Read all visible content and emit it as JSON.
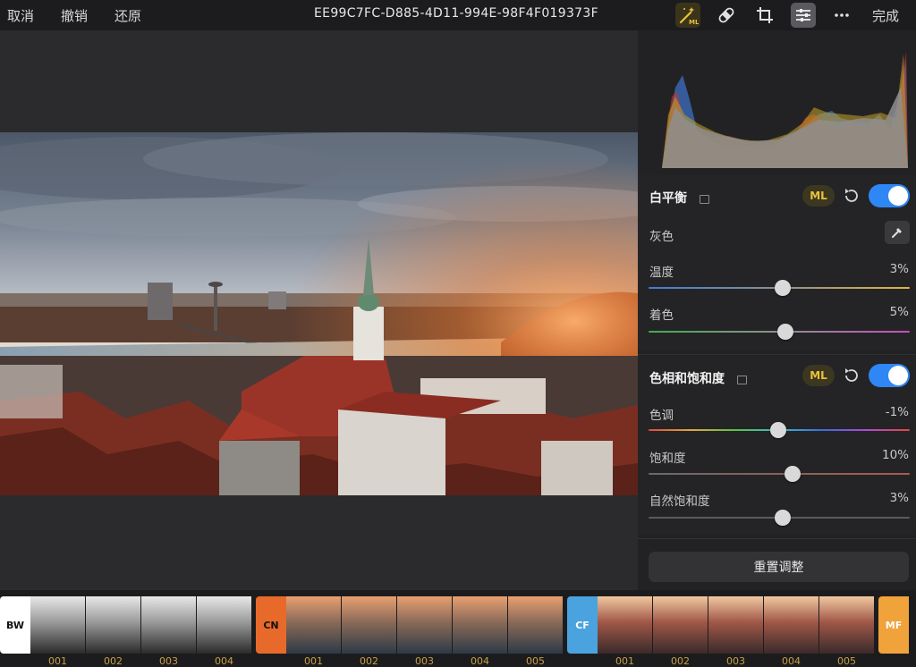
{
  "toolbar": {
    "cancel_label": "取消",
    "undo_label": "撤销",
    "redo_label": "还原",
    "title": "EE99C7FC-D885-4D11-994E-98F4F019373F",
    "ml_icon_label": "ML",
    "done_label": "完成"
  },
  "histogram": {
    "colors": {
      "red": "#c0392b",
      "green": "#6aa84f",
      "blue": "#3d6fc4",
      "luma": "#8e8e8e",
      "yellow": "#c9a227"
    }
  },
  "white_balance": {
    "title": "白平衡",
    "ml_label": "ML",
    "enabled": true,
    "gray_label": "灰色",
    "temperature": {
      "label": "温度",
      "value_text": "3%",
      "value": 3
    },
    "tint": {
      "label": "着色",
      "value_text": "5%",
      "value": 5
    }
  },
  "hue_saturation": {
    "title": "色相和饱和度",
    "ml_label": "ML",
    "enabled": true,
    "hue": {
      "label": "色调",
      "value_text": "-1%",
      "value": -1
    },
    "saturation": {
      "label": "饱和度",
      "value_text": "10%",
      "value": 10
    },
    "vibrance": {
      "label": "自然饱和度",
      "value_text": "3%",
      "value": 3
    }
  },
  "reset_button_label": "重置调整",
  "filters": {
    "groups": [
      {
        "tag": "BW",
        "color": "#ffffff",
        "text_color": "#111111",
        "items": [
          "001",
          "002",
          "003",
          "004"
        ]
      },
      {
        "tag": "CN",
        "color": "#e86a2a",
        "text_color": "#111111",
        "items": [
          "001",
          "002",
          "003",
          "004",
          "005"
        ]
      },
      {
        "tag": "CF",
        "color": "#4aa3de",
        "text_color": "#ffffff",
        "items": [
          "001",
          "002",
          "003",
          "004",
          "005"
        ]
      },
      {
        "tag": "MF",
        "color": "#f0a23b",
        "text_color": "#ffffff",
        "items": []
      }
    ]
  },
  "accent_color": "#2f87f6",
  "ml_color": "#e8c23a"
}
